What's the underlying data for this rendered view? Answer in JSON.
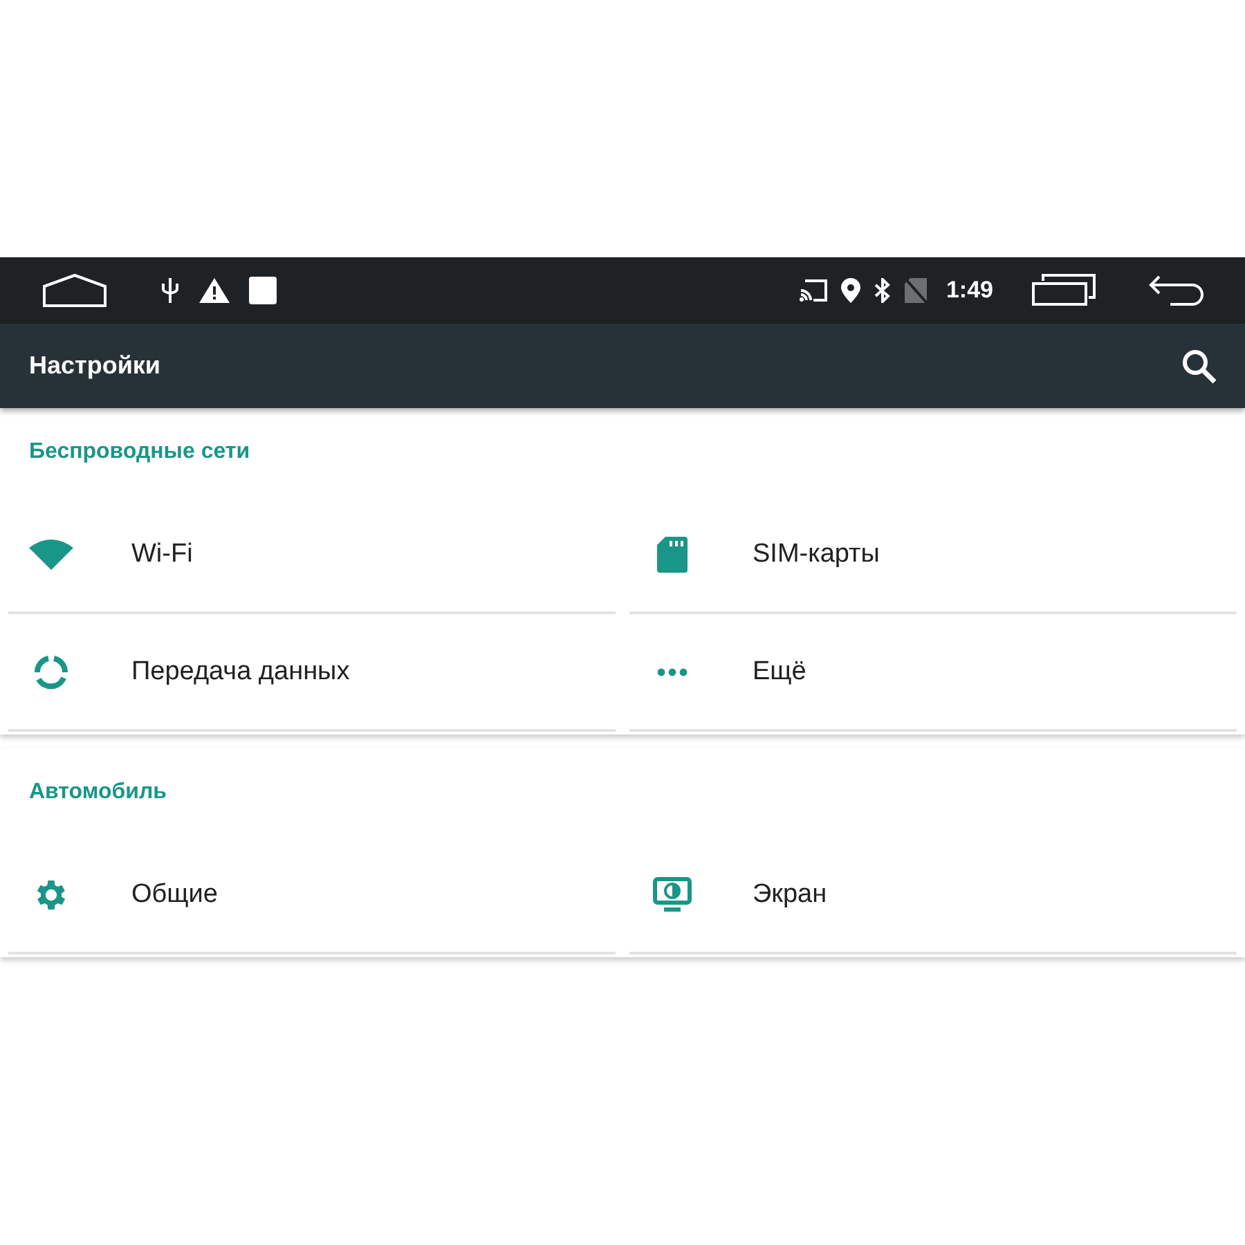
{
  "status_bar": {
    "time": "1:49"
  },
  "toolbar": {
    "title": "Настройки"
  },
  "sections": [
    {
      "title": "Беспроводные сети",
      "items": [
        {
          "label": "Wi-Fi"
        },
        {
          "label": "SIM-карты"
        },
        {
          "label": "Передача данных"
        },
        {
          "label": "Ещё"
        }
      ]
    },
    {
      "title": "Автомобиль",
      "items": [
        {
          "label": "Общие"
        },
        {
          "label": "Экран"
        }
      ]
    }
  ]
}
